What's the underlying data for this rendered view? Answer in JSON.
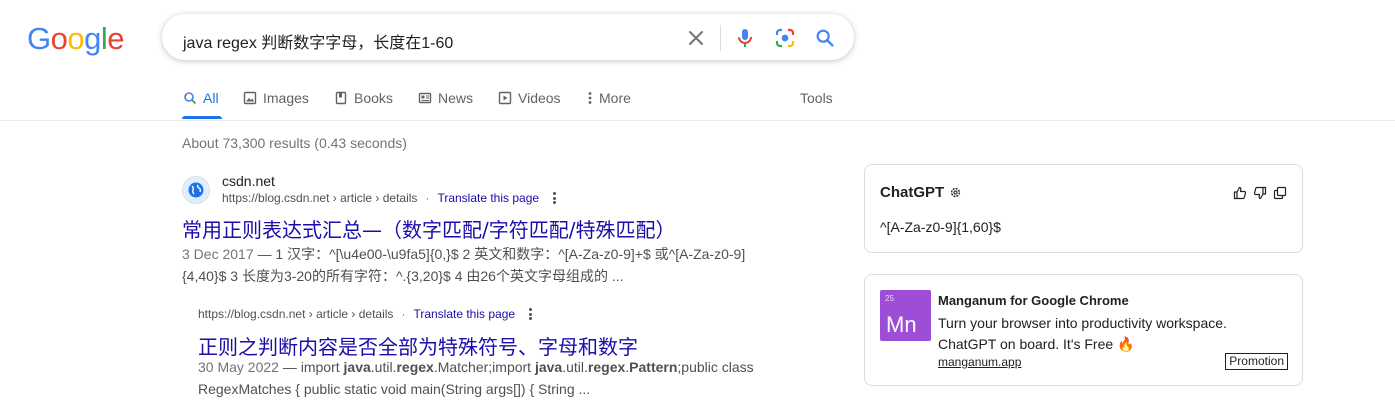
{
  "logo": {
    "letters": [
      "G",
      "o",
      "o",
      "g",
      "l",
      "e"
    ],
    "colors": [
      "#4285f4",
      "#ea4335",
      "#fbbc05",
      "#4285f4",
      "#34a853",
      "#ea4335"
    ]
  },
  "search": {
    "query": "java  regex 判断数字字母，长度在1-60"
  },
  "icons": {
    "clear": "close-icon",
    "voice": "microphone-icon",
    "lens": "camera-lens-icon",
    "search": "search-icon"
  },
  "tabs": [
    {
      "label": "All",
      "icon": "search-icon",
      "active": true
    },
    {
      "label": "Images",
      "icon": "image-icon"
    },
    {
      "label": "Books",
      "icon": "book-icon"
    },
    {
      "label": "News",
      "icon": "news-icon"
    },
    {
      "label": "Videos",
      "icon": "play-icon"
    },
    {
      "label": "More",
      "icon": "kebab-icon"
    }
  ],
  "tools_label": "Tools",
  "stats": "About 73,300 results (0.43 seconds)",
  "results": [
    {
      "site": "csdn.net",
      "url": "https://blog.csdn.net › article › details",
      "translate": "Translate this page",
      "title": "常用正则表达式汇总—（数字匹配/字符匹配/特殊匹配）",
      "date": "3 Dec 2017",
      "snippet_line1": " — 1 汉字：^[\\u4e00-\\u9fa5]{0,}$ 2 英文和数字：^[A-Za-z0-9]+$ 或^[A-Za-z0-9]",
      "snippet_line2": "{4,40}$ 3 长度为3-20的所有字符：^.{3,20}$ 4 由26个英文字母组成的 ..."
    },
    {
      "url": "https://blog.csdn.net › article › details",
      "translate": "Translate this page",
      "title": "正则之判断内容是否全部为特殊符号、字母和数字",
      "date": "30 May 2022",
      "snippet_parts": [
        " — import ",
        "java",
        ".util.",
        "regex",
        ".Matcher;import ",
        "java",
        ".util.",
        "regex",
        ".",
        "Pattern",
        ";public class"
      ],
      "snippet_line2": "RegexMatches { public static void main(String args[]) { String ..."
    }
  ],
  "chatgpt": {
    "title": "ChatGPT",
    "answer": "^[A-Za-z0-9]{1,60}$"
  },
  "ad": {
    "logo_number": "25",
    "logo_text": "Mn",
    "title": "Manganum for Google Chrome",
    "desc_line1": "Turn your browser into productivity workspace.",
    "desc_line2": "ChatGPT on board. It's Free 🔥",
    "link": "manganum.app",
    "badge": "Promotion"
  }
}
